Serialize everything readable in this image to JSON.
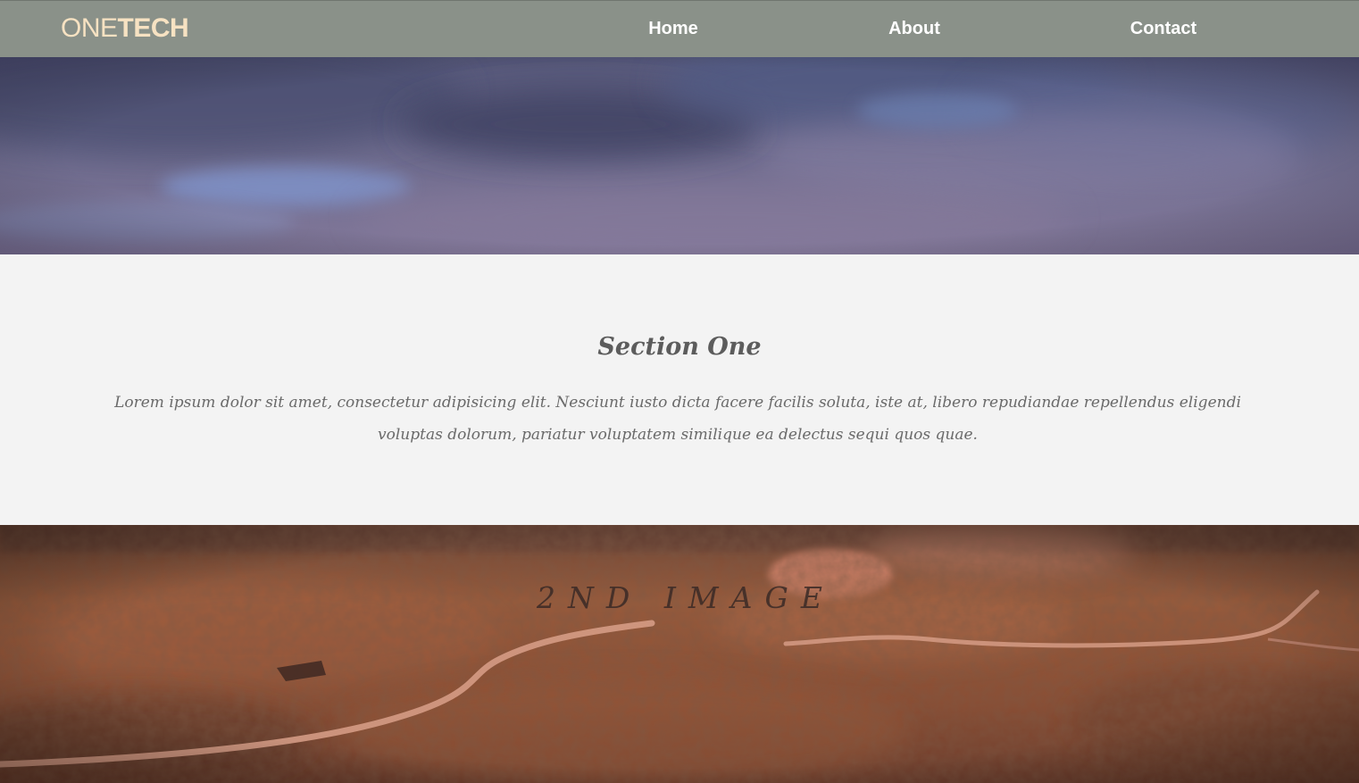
{
  "header": {
    "logo_light": "ONE",
    "logo_bold": "TECH",
    "nav": {
      "home": "Home",
      "about": "About",
      "contact": "Contact"
    }
  },
  "section_one": {
    "title": "Section One",
    "body": "Lorem ipsum dolor sit amet, consectetur adipisicing elit. Nesciunt iusto dicta facere facilis soluta, iste at, libero repudiandae repellendus eligendi voluptas dolorum, pariatur voluptatem similique ea delectus sequi quos quae."
  },
  "second_image": {
    "label": "2ND IMAGE"
  },
  "colors": {
    "navbar_bg": "#8a9189",
    "logo": "#f7e2c2",
    "nav_link": "#ffffff",
    "section_bg": "#f3f3f3",
    "section_text": "#6a6a6a"
  }
}
